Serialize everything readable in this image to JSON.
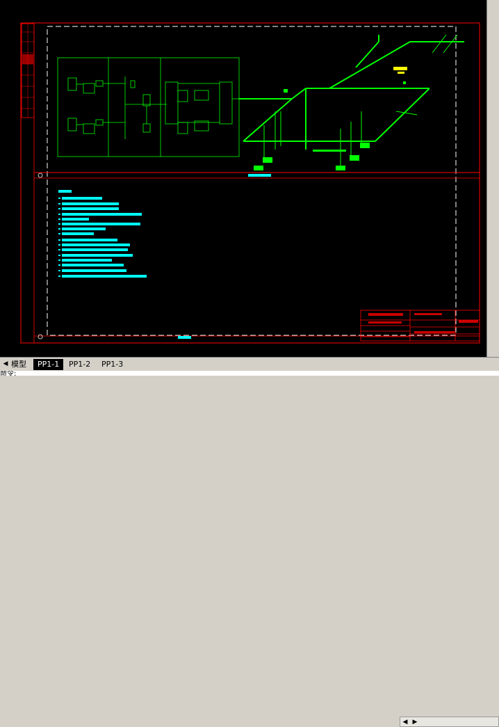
{
  "tabs": [
    {
      "label": "模型",
      "active": false
    },
    {
      "label": "PP1-1",
      "active": true
    },
    {
      "label": "PP1-2",
      "active": false
    },
    {
      "label": "PP1-3",
      "active": false
    }
  ],
  "tab_nav_icons": [
    "first-tab-icon",
    "prev-tab-icon",
    "next-tab-icon",
    "last-tab-icon"
  ],
  "command_line": "命令:",
  "colors": {
    "canvas": "#000000",
    "frame": "#ff0000",
    "schematic": "#00ff00",
    "notes": "#00ffff",
    "highlight": "#ffff00",
    "dash_border": "#ffffff"
  }
}
